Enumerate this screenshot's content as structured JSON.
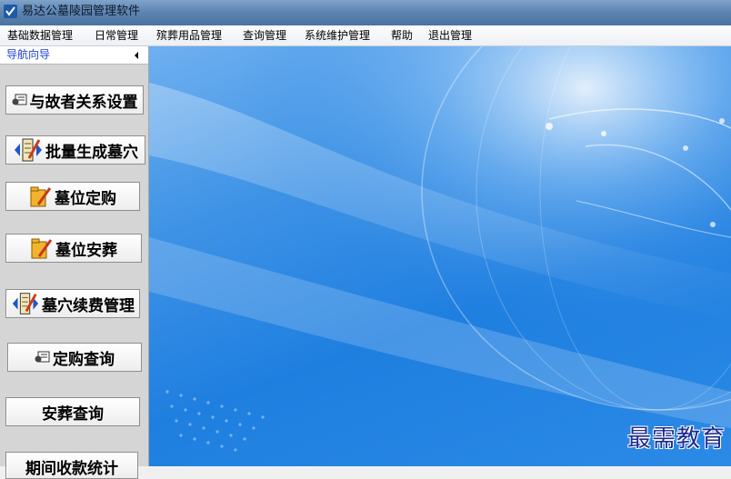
{
  "window": {
    "title": "易达公墓陵园管理软件"
  },
  "menu": [
    "基础数据管理",
    "日常管理",
    "殡葬用品管理",
    "查询管理",
    "系统维护管理",
    "帮助",
    "退出管理"
  ],
  "nav": {
    "title": "导航向导",
    "buttons": [
      {
        "label": "与故者关系设置",
        "icon": "card-icon"
      },
      {
        "label": "批量生成墓穴",
        "icon": "edit-book-icon"
      },
      {
        "label": "墓位定购",
        "icon": "folder-edit-icon"
      },
      {
        "label": "墓位安葬",
        "icon": "folder-edit-icon"
      },
      {
        "label": "墓穴续费管理",
        "icon": "edit-book-icon"
      },
      {
        "label": "定购查询",
        "icon": "card-icon"
      },
      {
        "label": "安葬查询",
        "icon": ""
      },
      {
        "label": "期间收款统计",
        "icon": ""
      }
    ]
  },
  "watermark": "最需教育",
  "colors": {
    "nav_title": "#1a3fd6",
    "content_bg": "#1f7fe0",
    "watermark": "#1d2b8f"
  }
}
